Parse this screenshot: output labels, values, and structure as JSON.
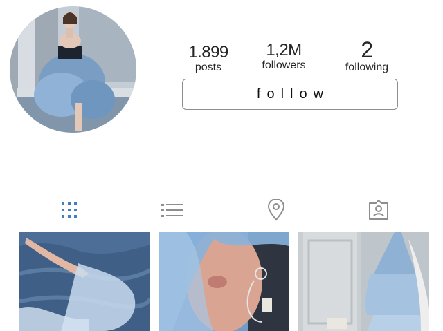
{
  "profile": {
    "posts": {
      "count": "1.899",
      "label": "posts"
    },
    "followers": {
      "count": "1,2M",
      "label": "followers"
    },
    "following": {
      "count": "2",
      "label": "following"
    }
  },
  "follow_button": {
    "label": "follow"
  },
  "tabs": [
    {
      "name": "grid",
      "icon": "grid-icon",
      "active": true
    },
    {
      "name": "list",
      "icon": "list-icon",
      "active": false
    },
    {
      "name": "location",
      "icon": "location-pin-icon",
      "active": false
    },
    {
      "name": "tagged",
      "icon": "tagged-person-icon",
      "active": false
    }
  ],
  "colors": {
    "accent": "#3d7fc4",
    "icon_inactive": "#8e8e8e",
    "border": "#8e8e8e"
  },
  "photos": [
    {
      "description": "hand reaching over water with sheer blue sleeve"
    },
    {
      "description": "face veiled in blue tulle with hoop earring"
    },
    {
      "description": "blue ruffled dress hanging by a white door"
    }
  ]
}
